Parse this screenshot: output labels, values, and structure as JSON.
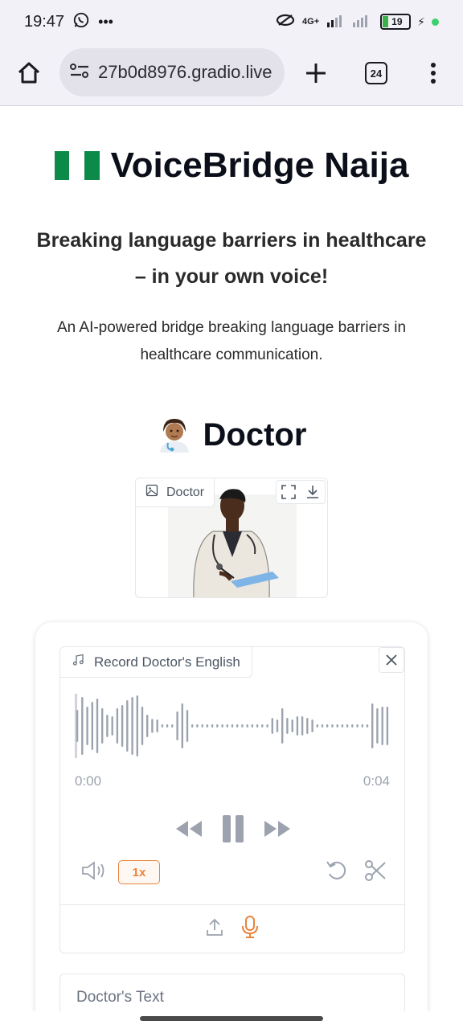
{
  "status_bar": {
    "time": "19:47",
    "network": "4G+",
    "battery": "19"
  },
  "browser": {
    "url": "27b0d8976.gradio.live",
    "tab_count": "24"
  },
  "page": {
    "title": "VoiceBridge Naija",
    "subtitle": "Breaking language barriers in healthcare – in your own voice!",
    "description": "An AI-powered bridge breaking language barriers in healthcare communication.",
    "section_heading": "Doctor",
    "image_label": "Doctor",
    "audio": {
      "label": "Record Doctor's English",
      "time_start": "0:00",
      "time_end": "0:04",
      "playback_rate": "1x",
      "waveform": [
        0.5,
        0.9,
        0.6,
        0.75,
        0.85,
        0.55,
        0.35,
        0.3,
        0.55,
        0.65,
        0.8,
        0.9,
        0.95,
        0.6,
        0.35,
        0.22,
        0.2,
        0.05,
        0.05,
        0.05,
        0.45,
        0.7,
        0.5,
        0.05,
        0.05,
        0.05,
        0.05,
        0.05,
        0.05,
        0.05,
        0.05,
        0.05,
        0.05,
        0.05,
        0.05,
        0.05,
        0.05,
        0.05,
        0.05,
        0.25,
        0.2,
        0.55,
        0.25,
        0.2,
        0.3,
        0.3,
        0.25,
        0.2,
        0.05,
        0.05,
        0.05,
        0.05,
        0.05,
        0.05,
        0.05,
        0.05,
        0.05,
        0.05,
        0.05,
        0.7,
        0.55,
        0.6,
        0.6
      ]
    },
    "text_box_label": "Doctor's Text"
  },
  "colors": {
    "accent": "#e8843c",
    "flag_green": "#0b8a4a",
    "waveform": "#9ca3af"
  }
}
